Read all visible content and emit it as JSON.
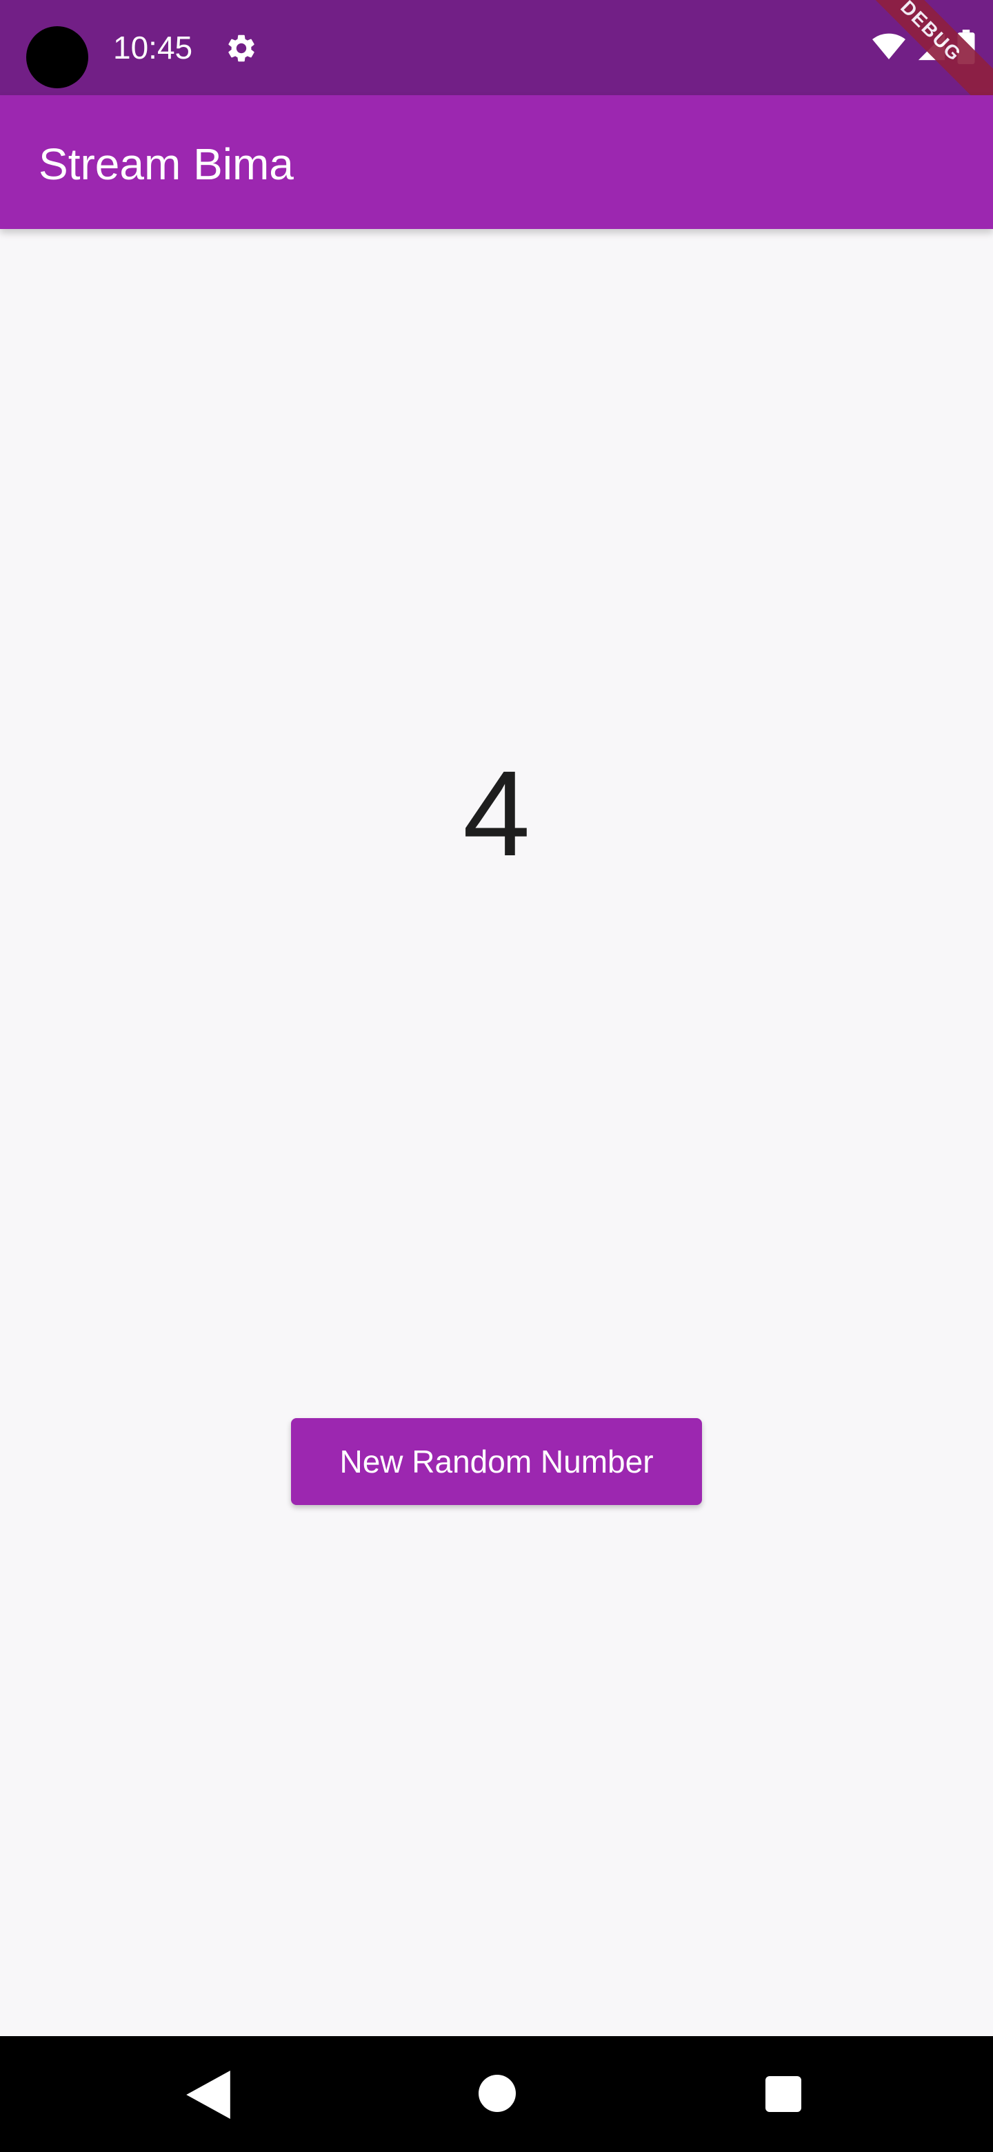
{
  "status_bar": {
    "time": "10:45",
    "icons": [
      "camera-cutout-icon",
      "settings-gear-icon",
      "wifi-icon",
      "signal-icon",
      "battery-icon"
    ],
    "debug_banner": "DEBUG"
  },
  "app_bar": {
    "title": "Stream Bima",
    "color": "#9c27b0"
  },
  "main": {
    "random_number": "4",
    "button_label": "New Random Number"
  },
  "nav_bar": {
    "icons": [
      "back-icon",
      "home-icon",
      "recents-icon"
    ]
  },
  "colors": {
    "accent": "#9c27b0",
    "status_bar": "#721f86",
    "background": "#f8f7f9"
  }
}
